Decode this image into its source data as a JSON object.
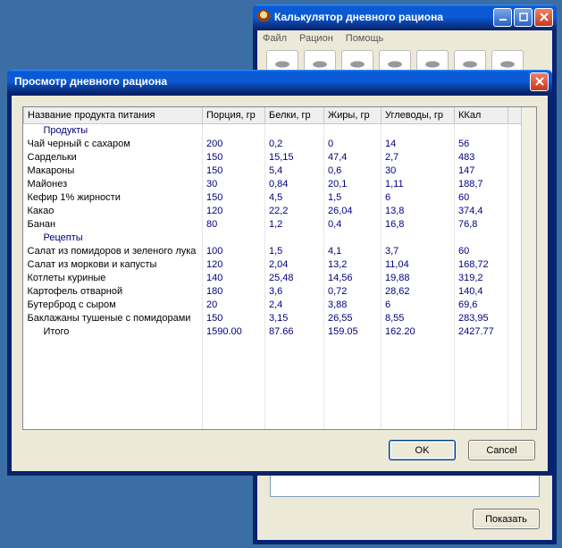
{
  "back_window": {
    "title": "Калькулятор дневного рациона",
    "menu": [
      "Файл",
      "Рацион",
      "Помощь"
    ],
    "show_btn": "Показать"
  },
  "dialog": {
    "title": "Просмотр дневного рациона",
    "headers": {
      "name": "Название продукта питания",
      "portion": "Порция, гр",
      "protein": "Белки, гр",
      "fat": "Жиры, гр",
      "carbs": "Углеводы, гр",
      "kcal": "ККал"
    },
    "sections": {
      "products": "Продукты",
      "recipes": "Рецепты"
    },
    "rows_products": [
      {
        "name": "Чай черный с сахаром",
        "portion": "200",
        "protein": "0,2",
        "fat": "0",
        "carbs": "14",
        "kcal": "56"
      },
      {
        "name": "Сардельки",
        "portion": "150",
        "protein": "15,15",
        "fat": "47,4",
        "carbs": "2,7",
        "kcal": "483"
      },
      {
        "name": "Макароны",
        "portion": "150",
        "protein": "5,4",
        "fat": "0,6",
        "carbs": "30",
        "kcal": "147"
      },
      {
        "name": "Майонез",
        "portion": "30",
        "protein": "0,84",
        "fat": "20,1",
        "carbs": "1,11",
        "kcal": "188,7"
      },
      {
        "name": "Кефир 1% жирности",
        "portion": "150",
        "protein": "4,5",
        "fat": "1,5",
        "carbs": "6",
        "kcal": "60"
      },
      {
        "name": "Какао",
        "portion": "120",
        "protein": "22,2",
        "fat": "26,04",
        "carbs": "13,8",
        "kcal": "374,4"
      },
      {
        "name": "Банан",
        "portion": "80",
        "protein": "1,2",
        "fat": "0,4",
        "carbs": "16,8",
        "kcal": "76,8"
      }
    ],
    "rows_recipes": [
      {
        "name": "Салат из помидоров и зеленого лука",
        "portion": "100",
        "protein": "1,5",
        "fat": "4,1",
        "carbs": "3,7",
        "kcal": "60"
      },
      {
        "name": "Салат из моркови и капусты",
        "portion": "120",
        "protein": "2,04",
        "fat": "13,2",
        "carbs": "11,04",
        "kcal": "168,72"
      },
      {
        "name": "Котлеты куриные",
        "portion": "140",
        "protein": "25,48",
        "fat": "14,56",
        "carbs": "19,88",
        "kcal": "319,2"
      },
      {
        "name": "Картофель отварной",
        "portion": "180",
        "protein": "3,6",
        "fat": "0,72",
        "carbs": "28,62",
        "kcal": "140,4"
      },
      {
        "name": "Бутерброд с сыром",
        "portion": "20",
        "protein": "2,4",
        "fat": "3,88",
        "carbs": "6",
        "kcal": "69,6"
      },
      {
        "name": "Баклажаны тушеные с помидорами",
        "portion": "150",
        "protein": "3,15",
        "fat": "26,55",
        "carbs": "8,55",
        "kcal": "283,95"
      }
    ],
    "totals": {
      "label": "Итого",
      "portion": "1590.00",
      "protein": "87.66",
      "fat": "159.05",
      "carbs": "162.20",
      "kcal": "2427.77"
    },
    "ok": "OK",
    "cancel": "Cancel"
  }
}
